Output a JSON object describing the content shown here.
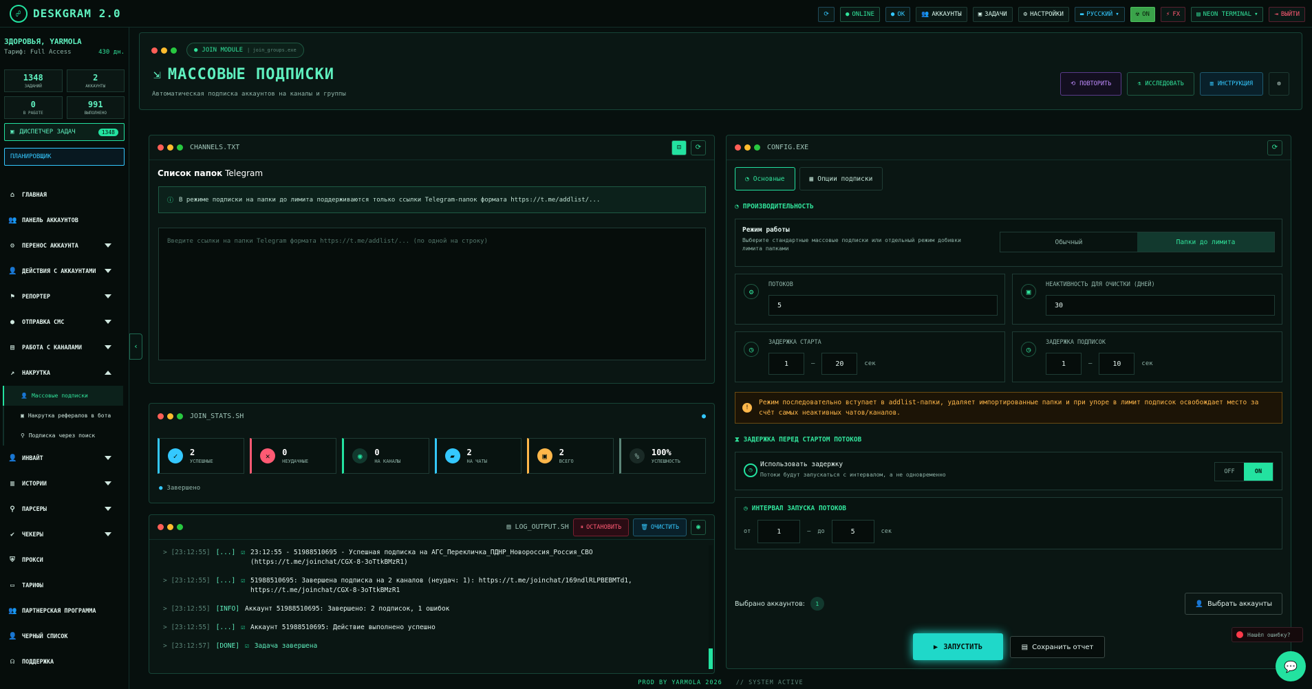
{
  "app": {
    "title": "DESKGRAM 2.0"
  },
  "topbar": {
    "online": "ONLINE",
    "ok": "OK",
    "accounts": "АККАУНТЫ",
    "tasks": "ЗАДАЧИ",
    "settings": "НАСТРОЙКИ",
    "language": "РУССКИЙ",
    "on": "ON",
    "fx": "FX",
    "theme": "NEON TERMINAL",
    "logout": "ВЫЙТИ"
  },
  "sidebar": {
    "greeting": "ЗДОРОВЬЯ, YARMOLA",
    "tariff": "Тариф: Full Access",
    "days": "430 дн.",
    "stats": [
      {
        "value": "1348",
        "label": "ЗАДАНИЙ"
      },
      {
        "value": "2",
        "label": "АККАУНТЫ"
      },
      {
        "value": "0",
        "label": "В РАБОТЕ"
      },
      {
        "value": "991",
        "label": "ВЫПОЛНЕНО"
      }
    ],
    "task_manager": "ДИСПЕТЧЕР ЗАДАЧ",
    "task_badge": "1348",
    "scheduler": "ПЛАНИРОВЩИК",
    "nav": [
      {
        "label": "ГЛАВНАЯ",
        "icon": "home-icon",
        "arrow": ""
      },
      {
        "label": "ПАНЕЛЬ АККАУНТОВ",
        "icon": "users-icon",
        "arrow": ""
      },
      {
        "label": "ПЕРЕНОС АККАУНТА",
        "icon": "transfer-icon",
        "arrow": "down"
      },
      {
        "label": "ДЕЙСТВИЯ С АККАУНТАМИ",
        "icon": "user-gear-icon",
        "arrow": "down"
      },
      {
        "label": "РЕПОРТЕР",
        "icon": "flag-icon",
        "arrow": "down"
      },
      {
        "label": "ОТПРАВКА СМС",
        "icon": "chat-icon",
        "arrow": "down"
      },
      {
        "label": "РАБОТА С КАНАЛАМИ",
        "icon": "briefcase-icon",
        "arrow": "down"
      },
      {
        "label": "НАКРУТКА",
        "icon": "chart-icon",
        "arrow": "up"
      }
    ],
    "subnav": [
      {
        "label": "Массовые подписки"
      },
      {
        "label": "Накрутка рефералов в бота"
      },
      {
        "label": "Подписка через поиск"
      }
    ],
    "nav2": [
      {
        "label": "ИНВАЙТ",
        "icon": "invite-icon",
        "arrow": "down"
      },
      {
        "label": "ИСТОРИИ",
        "icon": "stories-icon",
        "arrow": "down"
      },
      {
        "label": "ПАРСЕРЫ",
        "icon": "search-icon",
        "arrow": "down"
      },
      {
        "label": "ЧЕКЕРЫ",
        "icon": "check-icon",
        "arrow": "down"
      },
      {
        "label": "ПРОКСИ",
        "icon": "shield-icon",
        "arrow": ""
      },
      {
        "label": "ТАРИФЫ",
        "icon": "card-icon",
        "arrow": ""
      },
      {
        "label": "ПАРТНЕРСКАЯ ПРОГРАММА",
        "icon": "partners-icon",
        "arrow": ""
      },
      {
        "label": "ЧЕРНЫЙ СПИСОК",
        "icon": "blacklist-icon",
        "arrow": ""
      },
      {
        "label": "ПОДДЕРЖКА",
        "icon": "headset-icon",
        "arrow": ""
      }
    ]
  },
  "header": {
    "module": "JOIN MODULE",
    "module_file": "join_groups.exe",
    "title": "МАССОВЫЕ ПОДПИСКИ",
    "subtitle": "Автоматическая подписка аккаунтов на каналы и группы",
    "repeat": "ПОВТОРИТЬ",
    "explore": "ИССЛЕДОВАТЬ",
    "guide": "ИНСТРУКЦИЯ"
  },
  "channels": {
    "file": "CHANNELS.TXT",
    "title_bold": "Список папок",
    "title_rest": " Telegram",
    "notice": "В режиме подписки на папки до лимита поддерживаются только ссылки Telegram-папок формата https://t.me/addlist/...",
    "placeholder": "Введите ссылки на папки Telegram формата https://t.me/addlist/... (по одной на строку)"
  },
  "join_stats": {
    "file": "JOIN_STATS.SH",
    "cards": [
      {
        "value": "2",
        "label": "УСПЕШНЫЕ",
        "color": "#34c8ff",
        "icon": "check-icon"
      },
      {
        "value": "0",
        "label": "НЕУДАЧНЫЕ",
        "color": "#ff5a73",
        "icon": "x-icon"
      },
      {
        "value": "0",
        "label": "НА КАНАЛЫ",
        "color": "#23e2a0",
        "icon": "broadcast-icon"
      },
      {
        "value": "2",
        "label": "НА ЧАТЫ",
        "color": "#34c8ff",
        "icon": "chat-icon"
      },
      {
        "value": "2",
        "label": "ВСЕГО",
        "color": "#ffb74a",
        "icon": "box-icon"
      },
      {
        "value": "100%",
        "label": "УСПЕШНОСТЬ",
        "color": "#5b8578",
        "icon": "percent-icon"
      }
    ],
    "status": "Завершено"
  },
  "log": {
    "file": "LOG_OUTPUT.SH",
    "stop": "ОСТАНОВИТЬ",
    "clear": "ОЧИСТИТЬ",
    "lines": [
      {
        "ts": "> [23:12:55]",
        "tag": "[...]",
        "check": true,
        "text": "23:12:55 - 51988510695 - Успешная подписка на АГС_Перекличка_ПДНР_Новороссия_Россия_СВО (https://t.me/joinchat/CGX-8-3oTtkBMzR1)"
      },
      {
        "ts": "> [23:12:55]",
        "tag": "[...]",
        "check": true,
        "text": "51988510695: Завершена подписка на 2 каналов (неудач: 1): https://t.me/joinchat/169ndlRLPBEBMTd1, https://t.me/joinchat/CGX-8-3oTtkBMzR1"
      },
      {
        "ts": "> [23:12:55]",
        "tag": "[INFO]",
        "check": false,
        "text": "Аккаунт 51988510695: Завершено: 2 подписок, 1 ошибок"
      },
      {
        "ts": "> [23:12:55]",
        "tag": "[...]",
        "check": true,
        "text": "Аккаунт 51988510695: Действие выполнено успешно"
      },
      {
        "ts": "> [23:12:57]",
        "tag": "[DONE]",
        "check": true,
        "text": "Задача завершена"
      }
    ]
  },
  "config": {
    "file": "CONFIG.EXE",
    "tab_main": "Основные",
    "tab_options": "Опции подписки",
    "perf": "ПРОИЗВОДИТЕЛЬНОСТЬ",
    "mode_title": "Режим работы",
    "mode_desc": "Выберите стандартные массовые подписки или отдельный режим добивки лимита папками",
    "mode_normal": "Обычный",
    "mode_folders": "Папки до лимита",
    "threads_label": "ПОТОКОВ",
    "threads_value": "5",
    "inactive_label": "НЕАКТИВНОСТЬ ДЛЯ ОЧИСТКИ (ДНЕЙ)",
    "inactive_value": "30",
    "start_delay_label": "ЗАДЕРЖКА СТАРТА",
    "start_from": "1",
    "start_to": "20",
    "sub_delay_label": "ЗАДЕРЖКА ПОДПИСОК",
    "sub_from": "1",
    "sub_to": "10",
    "sec": "сек",
    "dash": "—",
    "warning": "Режим последовательно вступает в addlist-папки, удаляет импортированные папки и при упоре в лимит подписок освобождает место за счёт самых неактивных чатов/каналов.",
    "delay_section": "ЗАДЕРЖКА ПЕРЕД СТАРТОМ ПОТОКОВ",
    "use_delay": "Использовать задержку",
    "use_delay_desc": "Потоки будут запускаться с интервалом, а не одновременно",
    "off": "OFF",
    "on": "ON",
    "interval": "ИНТЕРВАЛ ЗАПУСКА ПОТОКОВ",
    "from": "от",
    "to": "до",
    "interval_from": "1",
    "interval_to": "5",
    "selected": "Выбрано аккаунтов:",
    "selected_count": "1",
    "choose": "Выбрать аккаунты"
  },
  "actions": {
    "run": "ЗАПУСТИТЬ",
    "save": "Сохранить отчет"
  },
  "footer": {
    "prod": "PROD BY YARMOLA 2026",
    "status": "// SYSTEM ACTIVE"
  },
  "bug": "Нашёл ошибку?"
}
